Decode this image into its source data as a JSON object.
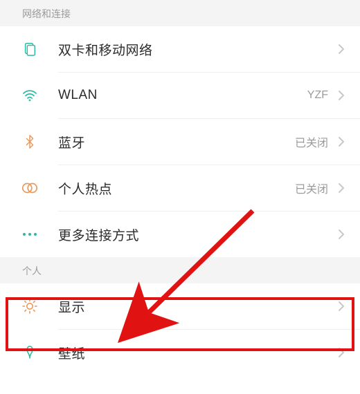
{
  "sections": {
    "network": {
      "header": "网络和连接",
      "items": [
        {
          "icon": "sim-icon",
          "label": "双卡和移动网络",
          "value": ""
        },
        {
          "icon": "wifi-icon",
          "label": "WLAN",
          "value": "YZF"
        },
        {
          "icon": "bluetooth-icon",
          "label": "蓝牙",
          "value": "已关闭"
        },
        {
          "icon": "hotspot-icon",
          "label": "个人热点",
          "value": "已关闭"
        },
        {
          "icon": "more-icon",
          "label": "更多连接方式",
          "value": ""
        }
      ]
    },
    "personal": {
      "header": "个人",
      "items": [
        {
          "icon": "display-icon",
          "label": "显示",
          "value": ""
        },
        {
          "icon": "wallpaper-icon",
          "label": "壁纸",
          "value": ""
        }
      ]
    }
  },
  "annotation": {
    "highlighted_item": "显示",
    "arrow_color": "#e11212"
  }
}
